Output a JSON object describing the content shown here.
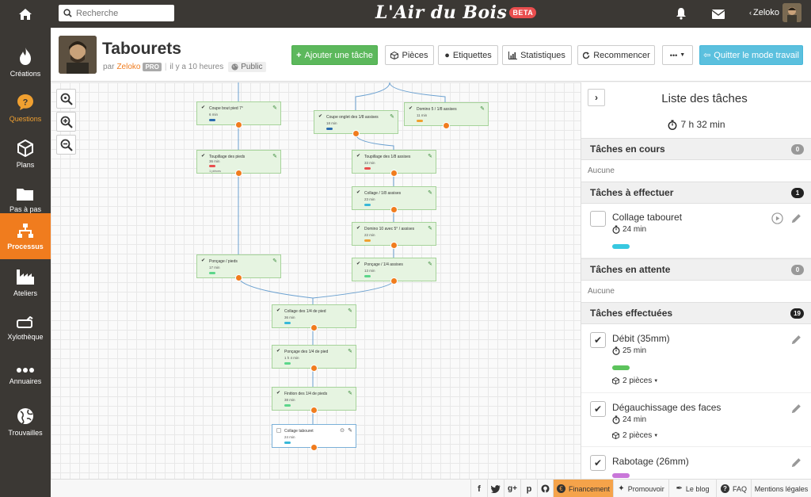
{
  "topbar": {
    "search_placeholder": "Recherche",
    "logo_text": "L'Air du Bois",
    "beta_label": "BETA",
    "user_name": "Zeloko"
  },
  "sidebar": {
    "items": [
      {
        "label": "Créations",
        "icon": "flame-icon"
      },
      {
        "label": "Questions",
        "icon": "question-bubble-icon"
      },
      {
        "label": "Plans",
        "icon": "cube-icon"
      },
      {
        "label": "Pas à pas",
        "icon": "folder-icon"
      },
      {
        "label": "Processus",
        "icon": "process-tree-icon"
      },
      {
        "label": "Ateliers",
        "icon": "factory-icon"
      },
      {
        "label": "Xylothèque",
        "icon": "log-icon"
      },
      {
        "label": "Annuaires",
        "icon": "dots-icon"
      },
      {
        "label": "Trouvailles",
        "icon": "globe-icon"
      }
    ]
  },
  "header": {
    "title": "Tabourets",
    "by_label": "par",
    "author": "Zeloko",
    "pro_badge": "PRO",
    "time_ago": "il y a 10 heures",
    "visibility": "Public",
    "buttons": {
      "add_task": "Ajouter une tâche",
      "pieces": "Pièces",
      "labels": "Etiquettes",
      "stats": "Statistiques",
      "restart": "Recommencer",
      "more": "•••",
      "quit": "Quitter le mode travail"
    }
  },
  "canvas": {
    "nodes": [
      {
        "title": "Coupe bout pied 7°",
        "time": "6 min",
        "bar": "#2b6cb0"
      },
      {
        "title": "Coupe onglet des 1/8 assises",
        "time": "18 min",
        "bar": "#2b6cb0"
      },
      {
        "title": "Domino 5 / 1/8 assises",
        "time": "11 min",
        "bar": "#f0a030"
      },
      {
        "title": "Toupillage des pieds",
        "time": "36 min",
        "bar": "#e94e4e",
        "extra": "1 pièces"
      },
      {
        "title": "Toupillage des 1/8 assises",
        "time": "33 min",
        "bar": "#e94e4e"
      },
      {
        "title": "Collage / 1/8 assises",
        "time": "23 min",
        "bar": "#38b8d8"
      },
      {
        "title": "Domino 10 avec 5° / assises",
        "time": "22 min",
        "bar": "#f0a030"
      },
      {
        "title": "Ponçage / pieds",
        "time": "17 min",
        "bar": "#5cd68a"
      },
      {
        "title": "Ponçage / 1/4 assises",
        "time": "13 min",
        "bar": "#5cd68a"
      },
      {
        "title": "Collage des 1/4 de pied",
        "time": "36 min",
        "bar": "#38b8d8"
      },
      {
        "title": "Ponçage des 1/4 de pied",
        "time": "1 h 4 min",
        "bar": "#5cd68a"
      },
      {
        "title": "Finition des 1/4 de pieds",
        "time": "38 min",
        "bar": "#5cd68a"
      },
      {
        "title": "Collage tabouret",
        "time": "24 min",
        "bar": "#38b8d8"
      }
    ]
  },
  "panel": {
    "title": "Liste des tâches",
    "total_time": "7 h 32 min",
    "sections": {
      "in_progress": {
        "title": "Tâches en cours",
        "count": "0",
        "empty": "Aucune"
      },
      "todo": {
        "title": "Tâches à effectuer",
        "count": "1"
      },
      "waiting": {
        "title": "Tâches en attente",
        "count": "0",
        "empty": "Aucune"
      },
      "done": {
        "title": "Tâches effectuées",
        "count": "19"
      }
    },
    "todo_tasks": [
      {
        "name": "Collage tabouret",
        "time": "24 min",
        "color": "#38c8e0"
      }
    ],
    "done_tasks": [
      {
        "name": "Débit (35mm)",
        "time": "25 min",
        "color": "#5cc35c",
        "pieces": "2 pièces"
      },
      {
        "name": "Dégauchissage des faces",
        "time": "24 min",
        "color": "#5cc35c",
        "pieces": "2 pièces"
      },
      {
        "name": "Rabotage (26mm)",
        "time": "",
        "color": "#c977d9"
      }
    ]
  },
  "footer": {
    "financement": "Financement",
    "promouvoir": "Promouvoir",
    "blog": "Le blog",
    "faq": "FAQ",
    "legal": "Mentions légales"
  }
}
